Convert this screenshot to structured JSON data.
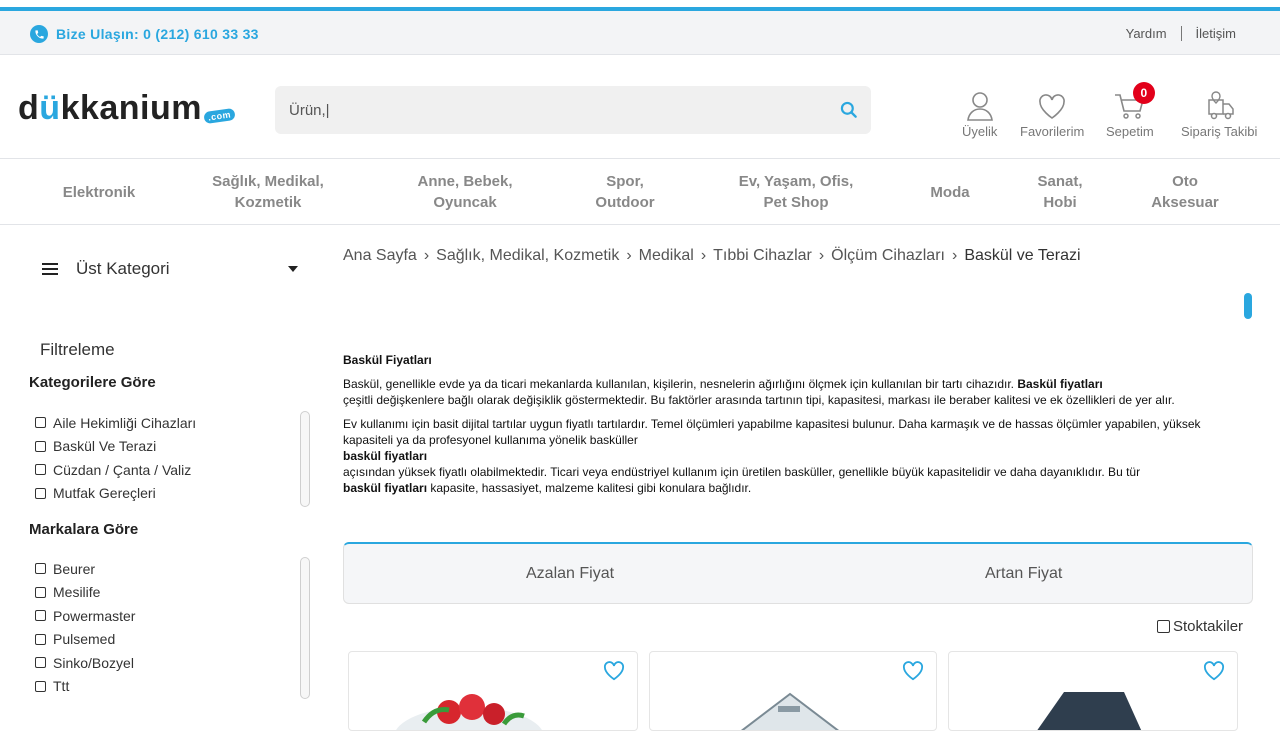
{
  "contact": {
    "phone_label": "Bize Ulaşın: 0 (212) 610 33 33"
  },
  "toplinks": {
    "help": "Yardım",
    "contact": "İletişim"
  },
  "logo": {
    "text_a": "d",
    "text_dots": "ü",
    "text_b": "kkanium",
    "com": ".com"
  },
  "search": {
    "value": "Ürün,|"
  },
  "header_icons": [
    {
      "label": "Üyelik",
      "icon": "user-icon"
    },
    {
      "label": "Favorilerim",
      "icon": "heart-icon"
    },
    {
      "label": "Sepetim",
      "icon": "cart-icon",
      "badge": "0"
    },
    {
      "label": "Sipariş Takibi",
      "icon": "truck-icon"
    }
  ],
  "categories": [
    {
      "l1": "Elektronik",
      "l2": ""
    },
    {
      "l1": "Sağlık, Medikal,",
      "l2": "Kozmetik"
    },
    {
      "l1": "Anne, Bebek,",
      "l2": "Oyuncak"
    },
    {
      "l1": "Spor,",
      "l2": "Outdoor"
    },
    {
      "l1": "Ev, Yaşam, Ofis,",
      "l2": "Pet Shop"
    },
    {
      "l1": "Moda",
      "l2": ""
    },
    {
      "l1": "Sanat,",
      "l2": "Hobi"
    },
    {
      "l1": "Oto",
      "l2": "Aksesuar"
    }
  ],
  "sidebar": {
    "ust_kategori": "Üst Kategori",
    "filtreleme": "Filtreleme",
    "kategori_title": "Kategorilere Göre",
    "kategori_items": [
      "Aile Hekimliği Cihazları",
      "Baskül Ve Terazi",
      "Cüzdan / Çanta / Valiz",
      "Mutfak Gereçleri"
    ],
    "marka_title": "Markalara Göre",
    "marka_items": [
      "Beurer",
      "Mesilife",
      "Powermaster",
      "Pulsemed",
      "Sinko/Bozyel",
      "Ttt"
    ]
  },
  "breadcrumb": [
    "Ana Sayfa",
    "Sağlık, Medikal, Kozmetik",
    "Medikal",
    "Tıbbi Cihazlar",
    "Ölçüm Cihazları",
    "Baskül ve Terazi"
  ],
  "description": {
    "title": "Baskül Fiyatları",
    "p1a": "Baskül, genellikle evde ya da ticari mekanlarda kullanılan, kişilerin, nesnelerin ağırlığını ölçmek için kullanılan bir tartı cihazıdır. ",
    "p1b": "Baskül fiyatları",
    "p1c": " çeşitli değişkenlere bağlı olarak değişiklik göstermektedir. Bu faktörler arasında tartının tipi, kapasitesi, markası ile beraber kalitesi ve ek özellikleri de yer alır.",
    "p2a": "Ev kullanımı için basit dijital tartılar uygun fiyatlı tartılardır. Temel ölçümleri yapabilme kapasitesi bulunur. Daha karmaşık ve de hassas ölçümler yapabilen, yüksek kapasiteli ya da profesyonel kullanıma yönelik basküller",
    "p2b": "baskül fiyatları",
    "p2c": "açısından yüksek fiyatlı olabilmektedir. Ticari veya endüstriyel kullanım için üretilen basküller, genellikle büyük kapasitelidir ve daha dayanıklıdır. Bu tür ",
    "p2d": "baskül fiyatları",
    "p2e": " kapasite, hassasiyet, malzeme kalitesi gibi konulara bağlıdır."
  },
  "sort": {
    "desc": "Azalan Fiyat",
    "asc": "Artan Fiyat"
  },
  "stock_filter": "Stoktakiler",
  "colors": {
    "accent": "#2aa7df",
    "badge": "#e2001a"
  }
}
